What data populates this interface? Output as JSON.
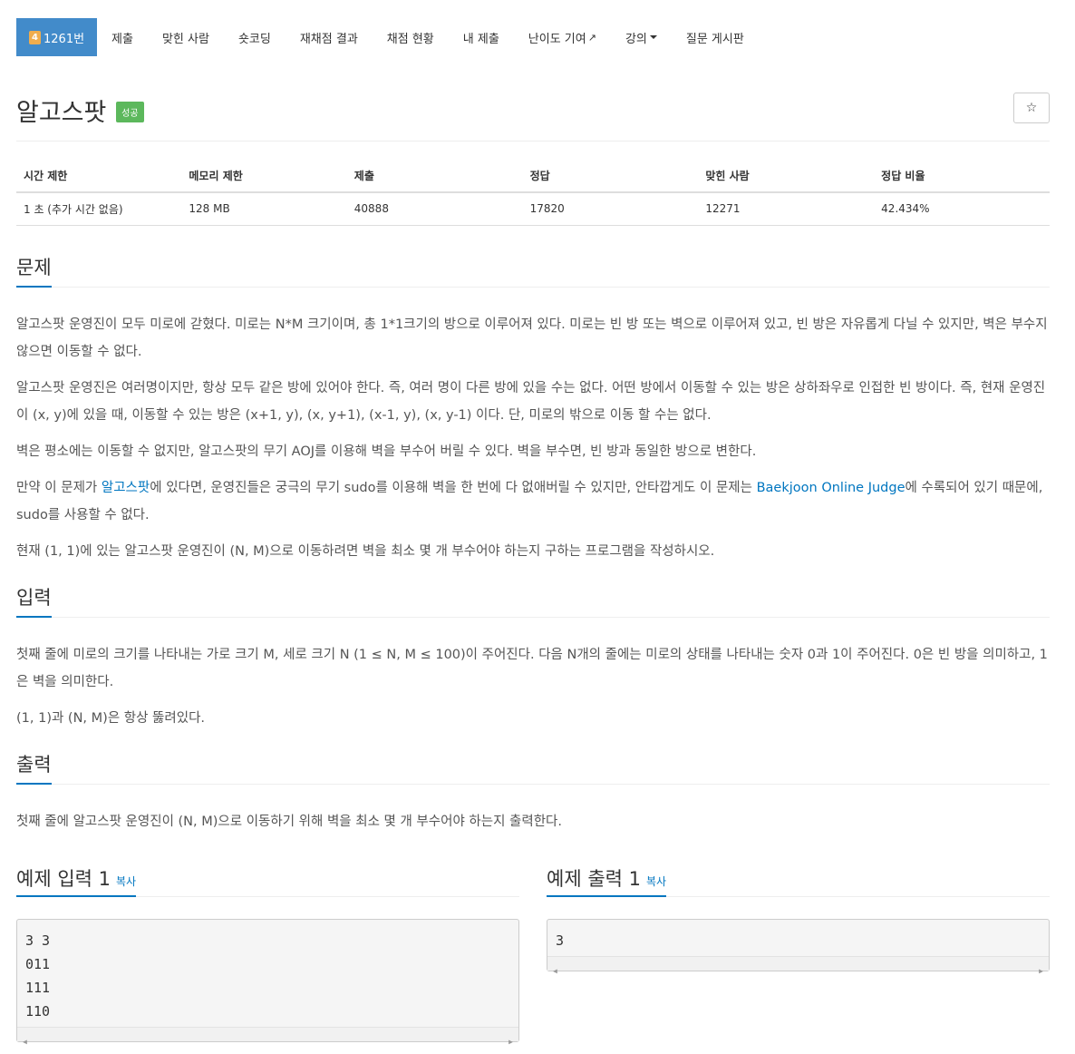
{
  "nav": {
    "problem_tier": "4",
    "problem_label": "1261번",
    "items": [
      "제출",
      "맞힌 사람",
      "숏코딩",
      "재채점 결과",
      "채점 현황",
      "내 제출",
      "난이도 기여",
      "강의",
      "질문 게시판"
    ]
  },
  "header": {
    "title": "알고스팟",
    "badge": "성공",
    "star": "☆"
  },
  "stats": {
    "headers": [
      "시간 제한",
      "메모리 제한",
      "제출",
      "정답",
      "맞힌 사람",
      "정답 비율"
    ],
    "values": [
      "1 초 (추가 시간 없음)",
      "128 MB",
      "40888",
      "17820",
      "12271",
      "42.434%"
    ]
  },
  "problem": {
    "title": "문제",
    "p1": "알고스팟 운영진이 모두 미로에 갇혔다. 미로는 N*M 크기이며, 총 1*1크기의 방으로 이루어져 있다. 미로는 빈 방 또는 벽으로 이루어져 있고, 빈 방은 자유롭게 다닐 수 있지만, 벽은 부수지 않으면 이동할 수 없다.",
    "p2": "알고스팟 운영진은 여러명이지만, 항상 모두 같은 방에 있어야 한다. 즉, 여러 명이 다른 방에 있을 수는 없다. 어떤 방에서 이동할 수 있는 방은 상하좌우로 인접한 빈 방이다. 즉, 현재 운영진이 (x, y)에 있을 때, 이동할 수 있는 방은 (x+1, y), (x, y+1), (x-1, y), (x, y-1) 이다. 단, 미로의 밖으로 이동 할 수는 없다.",
    "p3": "벽은 평소에는 이동할 수 없지만, 알고스팟의 무기 AOJ를 이용해 벽을 부수어 버릴 수 있다. 벽을 부수면, 빈 방과 동일한 방으로 변한다.",
    "p4_a": "만약 이 문제가 ",
    "p4_link1": "알고스팟",
    "p4_b": "에 있다면, 운영진들은 궁극의 무기 sudo를 이용해 벽을 한 번에 다 없애버릴 수 있지만, 안타깝게도 이 문제는 ",
    "p4_link2": "Baekjoon Online Judge",
    "p4_c": "에 수록되어 있기 때문에, sudo를 사용할 수 없다.",
    "p5": "현재 (1, 1)에 있는 알고스팟 운영진이 (N, M)으로 이동하려면 벽을 최소 몇 개 부수어야 하는지 구하는 프로그램을 작성하시오."
  },
  "input": {
    "title": "입력",
    "p1": "첫째 줄에 미로의 크기를 나타내는 가로 크기 M, 세로 크기 N (1 ≤ N, M ≤ 100)이 주어진다. 다음 N개의 줄에는 미로의 상태를 나타내는 숫자 0과 1이 주어진다. 0은 빈 방을 의미하고, 1은 벽을 의미한다.",
    "p2": "(1, 1)과 (N, M)은 항상 뚫려있다."
  },
  "output": {
    "title": "출력",
    "p1": "첫째 줄에 알고스팟 운영진이 (N, M)으로 이동하기 위해 벽을 최소 몇 개 부수어야 하는지 출력한다."
  },
  "samples": {
    "input_title": "예제 입력 1",
    "output_title": "예제 출력 1",
    "copy_label": "복사",
    "input_code": "3 3\n011\n111\n110",
    "output_code": "3"
  }
}
